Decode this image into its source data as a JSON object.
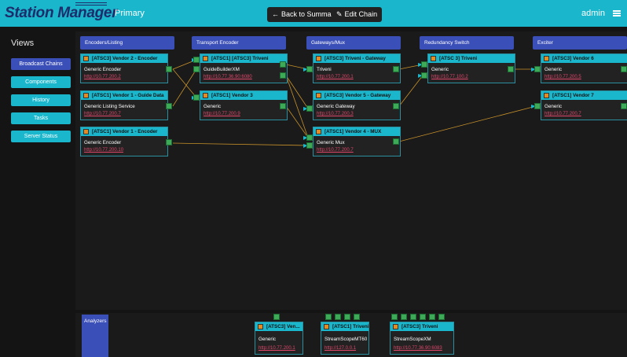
{
  "header": {
    "title": "Station Manager",
    "subtitle": "Primary",
    "back_label": "Back to Summary",
    "edit_label": "Edit Chain",
    "user": "admin",
    "accent": "#1ab6cc",
    "brand_dark": "#1d2c6b"
  },
  "sidebar": {
    "title": "Views",
    "items": [
      {
        "label": "Broadcast Chains",
        "active": true
      },
      {
        "label": "Components",
        "active": false
      },
      {
        "label": "History",
        "active": false
      },
      {
        "label": "Tasks",
        "active": false
      },
      {
        "label": "Server Status",
        "active": false
      }
    ]
  },
  "columns": [
    {
      "label": "Encoders/Listing"
    },
    {
      "label": "Transport Encoder"
    },
    {
      "label": "Gateways/Mux"
    },
    {
      "label": "Redundancy Switch"
    },
    {
      "label": "Exciter"
    }
  ],
  "nodes": {
    "enc1": {
      "title": "[ATSC3] Vendor 2 - Encoder",
      "type": "Generic Encoder",
      "link": "http://10.77.200.2"
    },
    "enc2": {
      "title": "[ATSC1] Vendor 1 - Guide Data",
      "type": "Generic Listing Service",
      "link": "http://10.77.200.7"
    },
    "enc3": {
      "title": "[ATSC1] Vendor 1 - Encoder",
      "type": "Generic Encoder",
      "link": "http://10.77.200.10"
    },
    "te1": {
      "title": "[ATSC1] [ATSC3] Triveni",
      "type": "GuideBuilderXM",
      "link": "http://10.77.36.90:6080"
    },
    "te2": {
      "title": "[ATSC1] Vendor 3",
      "type": "Generic",
      "link": "http://10.77.200.9"
    },
    "gw1": {
      "title": "[ATSC3] Triveni - Gateway",
      "type": "Triveni",
      "link": "http://10.77.200.1"
    },
    "gw2": {
      "title": "[ATSC3] Vendor 5 - Gateway",
      "type": "Generic Gateway",
      "link": "http://10.77.200.3"
    },
    "gw3": {
      "title": "[ATSC1] Vendor 4 - MUX",
      "type": "Generic Mux",
      "link": "http://10.77.200.7"
    },
    "rs1": {
      "title": "[ATSC 3] Triveni",
      "type": "Generic",
      "link": "http://10.77.100.2"
    },
    "ex1": {
      "title": "[ATSC3] Vendor 6",
      "type": "Generic",
      "link": "http://10.77.200.5"
    },
    "ex2": {
      "title": "[ATSC1] Vendor 7",
      "type": "Generic",
      "link": "http://10.77.200.7"
    }
  },
  "analyzers": {
    "label": "Analyzers",
    "nodes": [
      {
        "title": "[ATSC3] Ven...",
        "type": "Generic",
        "link": "http://10.77.200.1"
      },
      {
        "title": "[ATSC1] Triveni",
        "type": "StreamScopeMT60",
        "link": "http://127.0.0.1"
      },
      {
        "title": "[ATSC3] Triveni",
        "type": "StreamScopeXM",
        "link": "http://10.77.36.90:6083"
      }
    ]
  },
  "colors": {
    "column_header": "#3b4fb8",
    "port": "#3caa56",
    "wire": "#c8922a",
    "link": "#e0466a",
    "badge": "#e58b1f"
  }
}
